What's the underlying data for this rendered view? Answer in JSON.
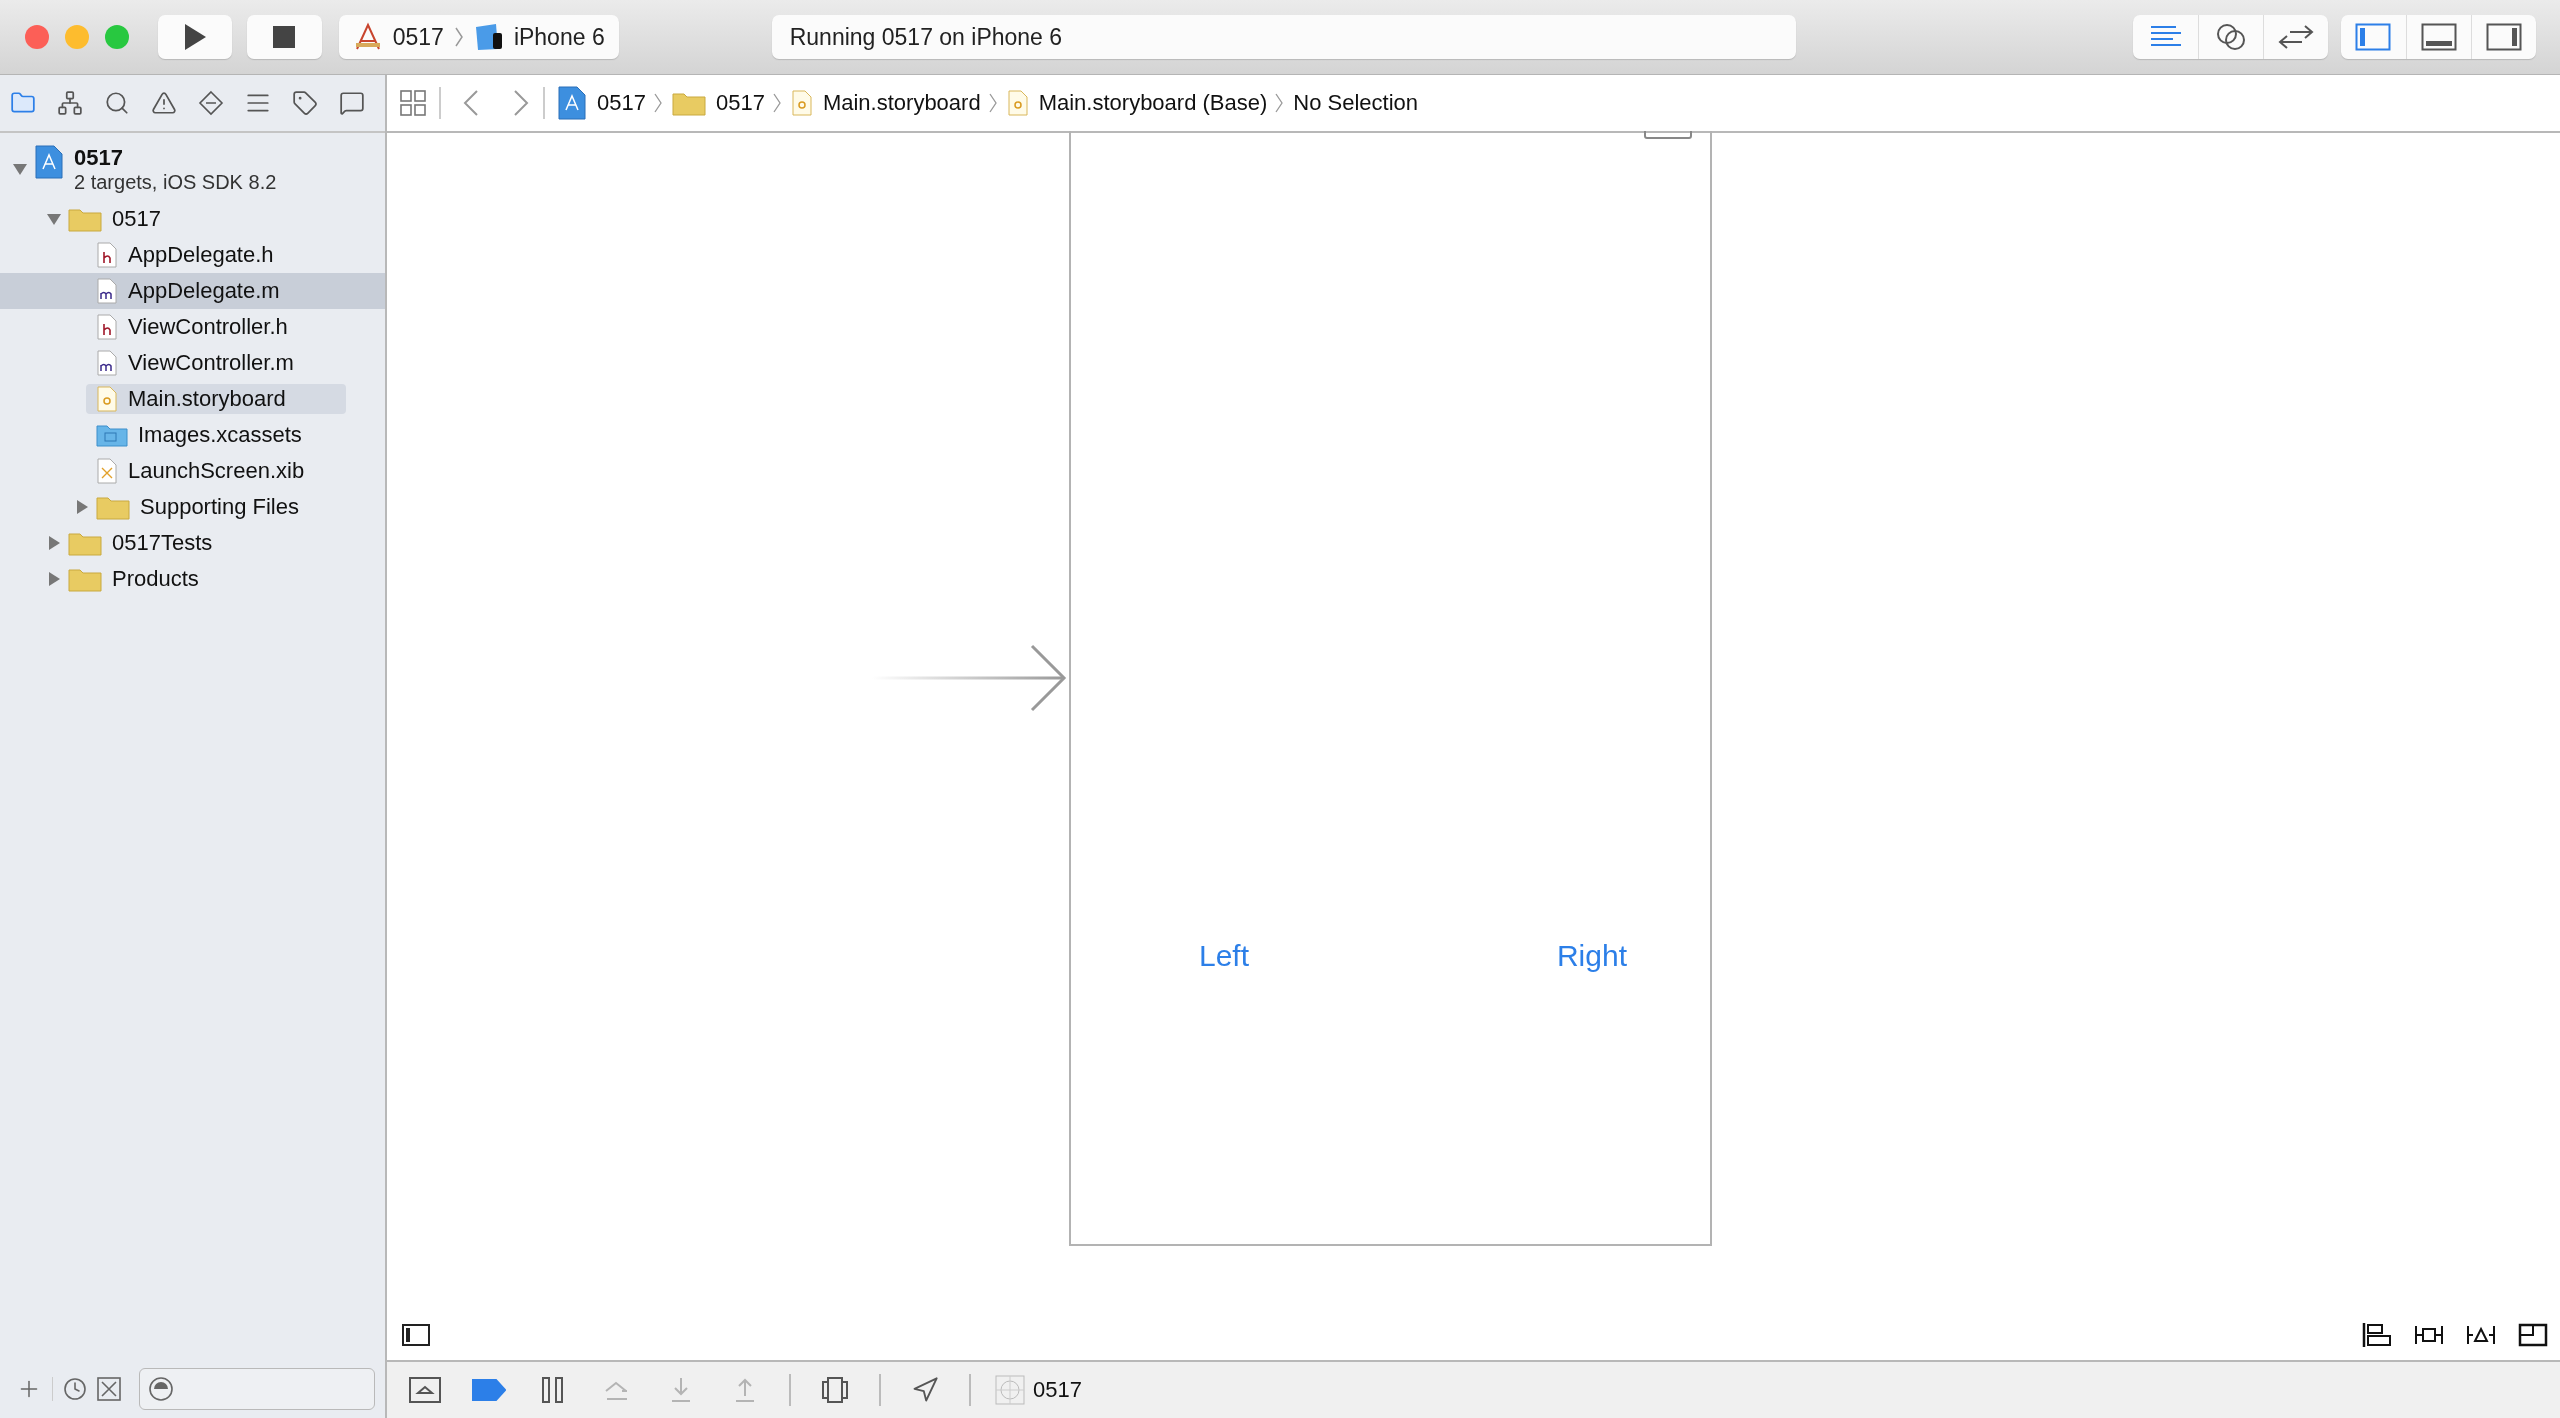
{
  "toolbar": {
    "scheme": {
      "project": "0517",
      "device": "iPhone 6"
    },
    "activity": "Running 0517 on iPhone 6",
    "editor_modes": [
      {
        "kind": "standard",
        "selected": true
      },
      {
        "kind": "assistant",
        "selected": false
      },
      {
        "kind": "version",
        "selected": false
      }
    ],
    "view_toggles": [
      {
        "kind": "navigator",
        "selected": true
      },
      {
        "kind": "debug",
        "selected": false
      },
      {
        "kind": "utilities",
        "selected": false
      }
    ]
  },
  "navigator_tabs": [
    {
      "kind": "project",
      "selected": true
    },
    {
      "kind": "symbol",
      "selected": false
    },
    {
      "kind": "find",
      "selected": false
    },
    {
      "kind": "issue",
      "selected": false
    },
    {
      "kind": "test",
      "selected": false
    },
    {
      "kind": "debug",
      "selected": false
    },
    {
      "kind": "breakpoint",
      "selected": false
    },
    {
      "kind": "report",
      "selected": false
    }
  ],
  "project_tree": {
    "name": "0517",
    "subtitle": "2 targets, iOS SDK 8.2",
    "expanded": true,
    "selected": false,
    "children": [
      {
        "name": "0517",
        "kind": "folder",
        "expanded": true,
        "selected": false,
        "open": false,
        "children": [
          {
            "name": "AppDelegate.h",
            "kind": "header",
            "selected": false,
            "open": false
          },
          {
            "name": "AppDelegate.m",
            "kind": "source",
            "selected": true,
            "open": false
          },
          {
            "name": "ViewController.h",
            "kind": "header",
            "selected": false,
            "open": false
          },
          {
            "name": "ViewController.m",
            "kind": "source",
            "selected": false,
            "open": false
          },
          {
            "name": "Main.storyboard",
            "kind": "storyboard",
            "selected": false,
            "open": true
          },
          {
            "name": "Images.xcassets",
            "kind": "assets",
            "selected": false,
            "open": false
          },
          {
            "name": "LaunchScreen.xib",
            "kind": "xib",
            "selected": false,
            "open": false
          },
          {
            "name": "Supporting Files",
            "kind": "folder",
            "expanded": false,
            "selected": false,
            "open": false
          }
        ]
      },
      {
        "name": "0517Tests",
        "kind": "folder",
        "expanded": false,
        "selected": false,
        "open": false
      },
      {
        "name": "Products",
        "kind": "folder",
        "expanded": false,
        "selected": false,
        "open": false
      }
    ]
  },
  "jump_bar": {
    "crumbs": [
      {
        "kind": "project",
        "label": "0517"
      },
      {
        "kind": "folder",
        "label": "0517"
      },
      {
        "kind": "storyboard",
        "label": "Main.storyboard"
      },
      {
        "kind": "storyboard",
        "label": "Main.storyboard (Base)"
      },
      {
        "kind": "none",
        "label": "No Selection"
      }
    ]
  },
  "scene": {
    "buttons": [
      "Left",
      "Right"
    ]
  },
  "debug_bar": {
    "breakpoints_on": true,
    "buttons": [
      {
        "kind": "hide",
        "disabled": false
      },
      {
        "kind": "breakpoints",
        "disabled": false
      },
      {
        "kind": "pause",
        "disabled": false
      },
      {
        "kind": "step-over",
        "disabled": true
      },
      {
        "kind": "step-in",
        "disabled": true
      },
      {
        "kind": "step-out",
        "disabled": true
      },
      {
        "kind": "view-debug",
        "disabled": false
      },
      {
        "kind": "location",
        "disabled": false
      }
    ],
    "process": "0517"
  }
}
